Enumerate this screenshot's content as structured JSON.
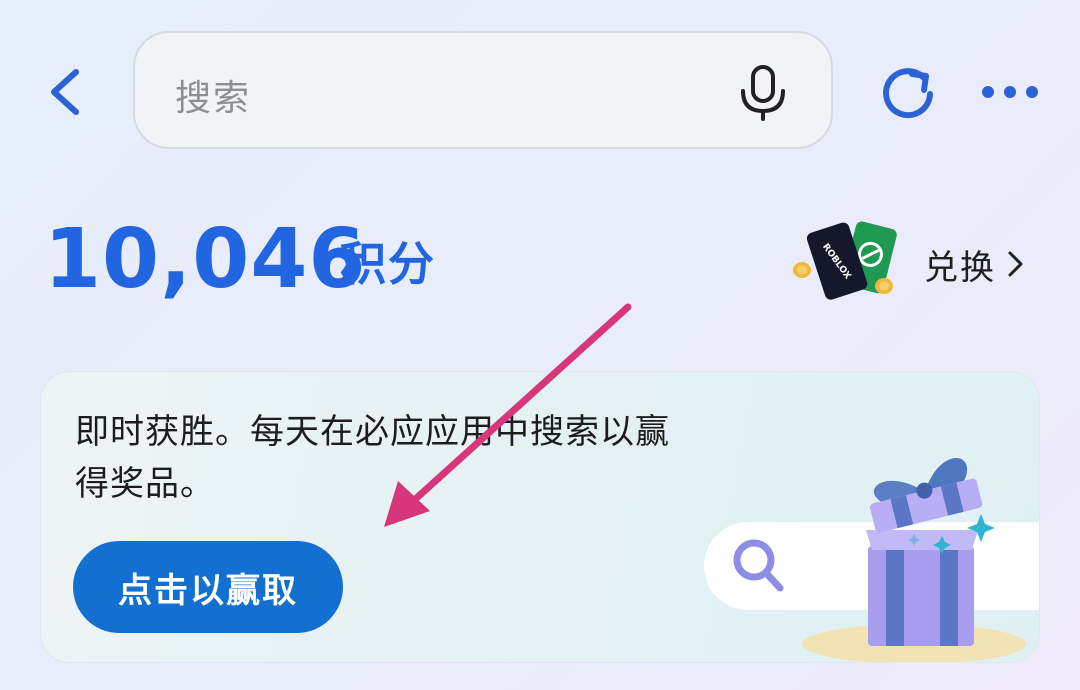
{
  "search": {
    "placeholder": "搜索"
  },
  "points": {
    "value": "10,046",
    "unit": "积分"
  },
  "redeem": {
    "label": "兑换",
    "card_text": "ROBLOX"
  },
  "promo": {
    "message": "即时获胜。每天在必应应用中搜索以赢得奖品。",
    "button_label": "点击以赢取"
  },
  "icons": {
    "back": "chevron-left-icon",
    "mic": "microphone-icon",
    "refresh": "refresh-icon",
    "more": "more-dots-icon",
    "redeem_chevron": "chevron-right-icon",
    "search_art": "magnifier-icon",
    "gift": "gift-box-icon",
    "arrow": "arrow-annotation-icon"
  },
  "colors": {
    "accent": "#2166e0",
    "button": "#1470d0",
    "arrow": "#d8367a"
  }
}
